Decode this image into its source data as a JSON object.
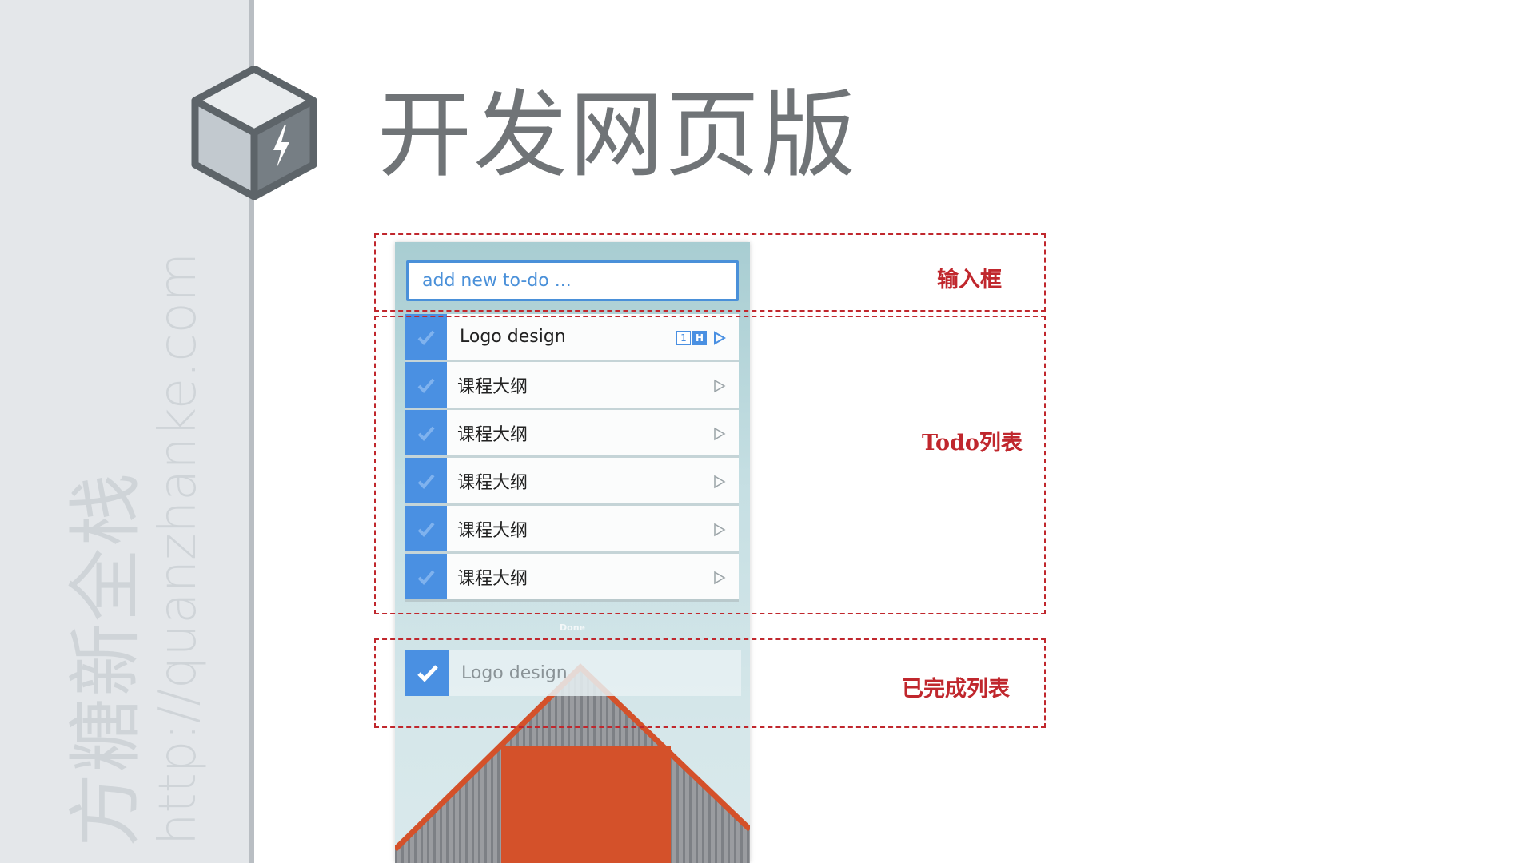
{
  "title": "开发网页版",
  "brand": {
    "name_cn": "方糖新全栈",
    "url": "http://quanzhanke.com"
  },
  "app": {
    "input_placeholder": "add new to-do ...",
    "todos": [
      {
        "text": "Logo design",
        "badge_count": "1",
        "badge_priority": "H"
      },
      {
        "text": "课程大纲"
      },
      {
        "text": "课程大纲"
      },
      {
        "text": "课程大纲"
      },
      {
        "text": "课程大纲"
      },
      {
        "text": "课程大纲"
      }
    ],
    "done_section_label": "Done",
    "done_items": [
      {
        "text": "Logo design"
      }
    ]
  },
  "annotations": {
    "input": "输入框",
    "todo_list": "Todo列表",
    "done_list": "已完成列表"
  },
  "colors": {
    "accent": "#4a90e2",
    "annotation": "#c0272d",
    "sidebar": "#e4e7ea",
    "title": "#707477",
    "roof": "#d4512a"
  }
}
